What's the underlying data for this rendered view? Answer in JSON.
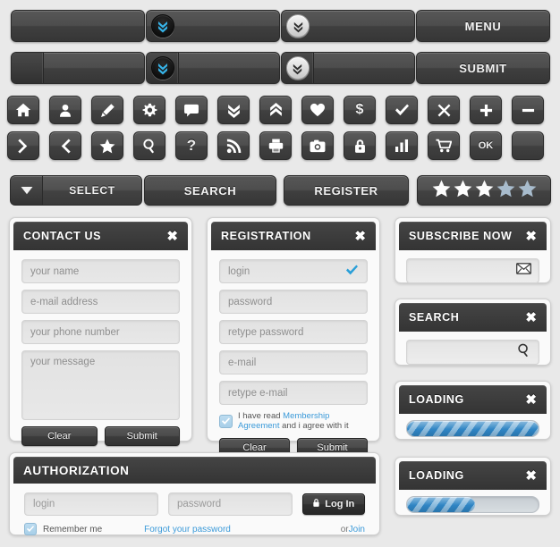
{
  "top_buttons": {
    "row1": [
      {
        "label": "",
        "icon": "none"
      },
      {
        "label": "",
        "icon": "chevron-double-down-blue-badge"
      },
      {
        "label": "",
        "icon": "chevron-double-down-gray-badge"
      },
      {
        "label": "MENU",
        "icon": "none"
      }
    ],
    "row2": [
      {
        "label": "",
        "icon": "none",
        "split": true
      },
      {
        "label": "",
        "icon": "chevron-double-down-blue-badge",
        "split": true
      },
      {
        "label": "",
        "icon": "chevron-double-down-gray-badge",
        "split": true
      },
      {
        "label": "SUBMIT",
        "icon": "none",
        "split": false
      }
    ]
  },
  "icon_row1": [
    "home-icon",
    "user-icon",
    "pencil-icon",
    "gear-icon",
    "chat-icon",
    "chevron-double-down-icon",
    "chevron-double-up-icon",
    "heart-icon",
    "dollar-icon",
    "check-icon",
    "close-x-icon",
    "plus-icon",
    "minus-icon"
  ],
  "icon_row2": [
    "chevron-right-icon",
    "chevron-left-icon",
    "star-icon",
    "search-icon",
    "question-icon",
    "rss-icon",
    "print-icon",
    "camera-icon",
    "lock-icon",
    "bar-chart-icon",
    "cart-icon",
    "ok-text-button",
    "blank-button"
  ],
  "ok_button_label": "OK",
  "action_bar": {
    "select_label": "SELECT",
    "search_label": "SEARCH",
    "register_label": "REGISTER",
    "rating": {
      "total": 5,
      "filled": 3
    }
  },
  "contact_panel": {
    "title": "CONTACT US",
    "close": "✖",
    "fields": [
      {
        "placeholder": "your name"
      },
      {
        "placeholder": "e-mail address"
      },
      {
        "placeholder": "your phone number"
      }
    ],
    "message_placeholder": "your message",
    "clear_label": "Clear",
    "submit_label": "Submit"
  },
  "registration_panel": {
    "title": "REGISTRATION",
    "close": "✖",
    "fields": [
      {
        "placeholder": "login",
        "valid": true
      },
      {
        "placeholder": "password",
        "valid": false
      },
      {
        "placeholder": "retype password",
        "valid": false
      },
      {
        "placeholder": "e-mail",
        "valid": false
      },
      {
        "placeholder": "retype e-mail",
        "valid": false
      }
    ],
    "agree_pre": "I have read ",
    "agree_link": "Membership Agreement",
    "agree_post": " and i agree with it",
    "agree_checked": true,
    "clear_label": "Clear",
    "submit_label": "Submit"
  },
  "subscribe_panel": {
    "title": "SUBSCRIBE NOW",
    "close": "✖",
    "input_placeholder": "",
    "icon": "envelope-icon"
  },
  "search_panel": {
    "title": "SEARCH",
    "close": "✖",
    "input_placeholder": "",
    "icon": "search-icon"
  },
  "loading_panel_1": {
    "title": "LOADING",
    "close": "✖",
    "progress_percent": 100
  },
  "loading_panel_2": {
    "title": "LOADING",
    "close": "✖",
    "progress_percent": 52
  },
  "authorization_panel": {
    "title": "AUTHORIZATION",
    "close": "",
    "login_placeholder": "login",
    "password_placeholder": "password",
    "login_button_label": "Log In",
    "login_button_icon": "lock-icon",
    "remember_label": "Remember me",
    "remember_checked": true,
    "forgot_label": "Forgot your password",
    "or_label": "or ",
    "join_label": "Join"
  },
  "colors": {
    "background": "#e9e9e9",
    "button_dark": "#4a4a4a",
    "panel_header": "#3b3b3b",
    "accent_blue": "#3b9ad9",
    "progress_blue": "#2f85c4",
    "star_empty": "#a8bccd",
    "link_blue": "#3b9ad9"
  }
}
